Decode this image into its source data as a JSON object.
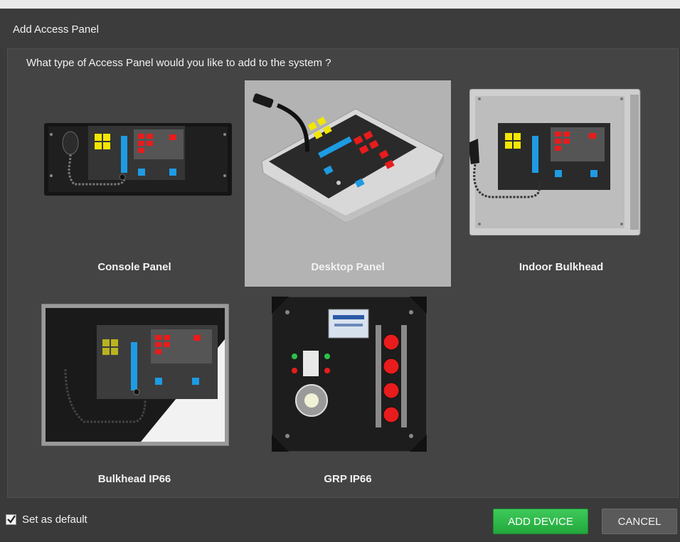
{
  "dialog": {
    "title": "Add Access Panel",
    "question": "What type of Access Panel would you like to add to the system ?"
  },
  "panels": [
    {
      "label": "Console Panel",
      "selected": false,
      "icon": "console-panel-image"
    },
    {
      "label": "Desktop Panel",
      "selected": true,
      "icon": "desktop-panel-image"
    },
    {
      "label": "Indoor Bulkhead",
      "selected": false,
      "icon": "indoor-bulkhead-image"
    },
    {
      "label": "Bulkhead IP66",
      "selected": false,
      "icon": "bulkhead-ip66-image"
    },
    {
      "label": "GRP IP66",
      "selected": false,
      "icon": "grp-ip66-image"
    }
  ],
  "footer": {
    "set_default_label": "Set as default",
    "set_default_checked": true,
    "add_label": "ADD DEVICE",
    "cancel_label": "CANCEL"
  },
  "colors": {
    "accent_green": "#2fb84a",
    "background": "#3a3a3a",
    "selected_tile": "#b3b3b3"
  }
}
